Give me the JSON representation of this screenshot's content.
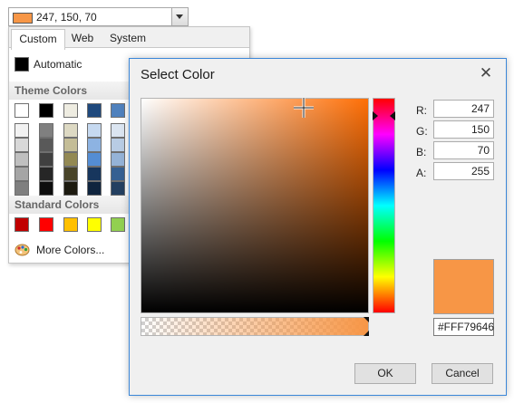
{
  "combo": {
    "color": "#f79646",
    "value": "247, 150, 70"
  },
  "dropdown": {
    "tabs": [
      {
        "label": "Custom",
        "active": true
      },
      {
        "label": "Web",
        "active": false
      },
      {
        "label": "System",
        "active": false
      }
    ],
    "automatic": {
      "label": "Automatic",
      "color": "#000000"
    },
    "theme_colors": {
      "header": "Theme Colors",
      "top_row": [
        "#ffffff",
        "#000000",
        "#eeece1",
        "#1f497d",
        "#4f81bd"
      ],
      "shades": [
        [
          "#f2f2f2",
          "#808080",
          "#ddd9c3",
          "#c6d9f0",
          "#dbe5f1"
        ],
        [
          "#d8d8d8",
          "#595959",
          "#c4bd97",
          "#8db3e2",
          "#b8cce4"
        ],
        [
          "#bfbfbf",
          "#404040",
          "#938953",
          "#548dd4",
          "#95b3d7"
        ],
        [
          "#a5a5a5",
          "#262626",
          "#494429",
          "#17365d",
          "#366092"
        ],
        [
          "#7f7f7f",
          "#0d0d0d",
          "#1d1b10",
          "#0f243e",
          "#244061"
        ]
      ]
    },
    "standard_colors": {
      "header": "Standard Colors",
      "colors": [
        "#c00000",
        "#ff0000",
        "#ffc000",
        "#ffff00",
        "#92d050"
      ]
    },
    "more_colors": {
      "label": "More Colors..."
    }
  },
  "dialog": {
    "title": "Select Color",
    "close_glyph": "✕",
    "channels": [
      {
        "label": "R:",
        "value": "247"
      },
      {
        "label": "G:",
        "value": "150"
      },
      {
        "label": "B:",
        "value": "70"
      },
      {
        "label": "A:",
        "value": "255"
      }
    ],
    "preview_color": "#f79646",
    "hex_value": "#FFF79646",
    "ok_label": "OK",
    "cancel_label": "Cancel"
  }
}
